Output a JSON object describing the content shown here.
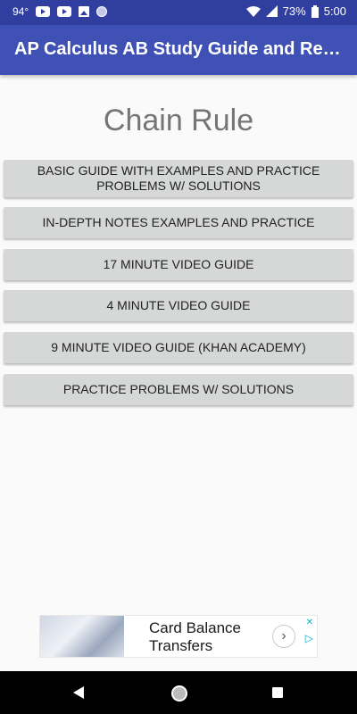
{
  "status_bar": {
    "temperature": "94°",
    "battery": "73%",
    "time": "5:00",
    "icons": [
      "youtube-icon",
      "youtube-icon",
      "photo-icon",
      "circle-icon",
      "wifi-icon",
      "signal-icon",
      "battery-icon"
    ]
  },
  "app_bar": {
    "title": "AP Calculus AB Study Guide and Resources",
    "color": "#3f51b5"
  },
  "page": {
    "title": "Chain Rule"
  },
  "buttons": [
    {
      "label": "BASIC GUIDE WITH EXAMPLES AND PRACTICE PROBLEMS W/ SOLUTIONS"
    },
    {
      "label": "IN-DEPTH NOTES EXAMPLES AND PRACTICE"
    },
    {
      "label": "17 MINUTE VIDEO GUIDE"
    },
    {
      "label": "4 MINUTE VIDEO GUIDE"
    },
    {
      "label": "9 MINUTE VIDEO GUIDE (KHAN ACADEMY)"
    },
    {
      "label": "PRACTICE PROBLEMS W/ SOLUTIONS"
    }
  ],
  "ad": {
    "text_line1": "Card Balance",
    "text_line2": "Transfers",
    "arrow": "›",
    "close": "✕",
    "choices": "▷"
  },
  "nav_bar": {
    "icons": [
      "back-icon",
      "home-icon",
      "recent-apps-icon"
    ]
  }
}
